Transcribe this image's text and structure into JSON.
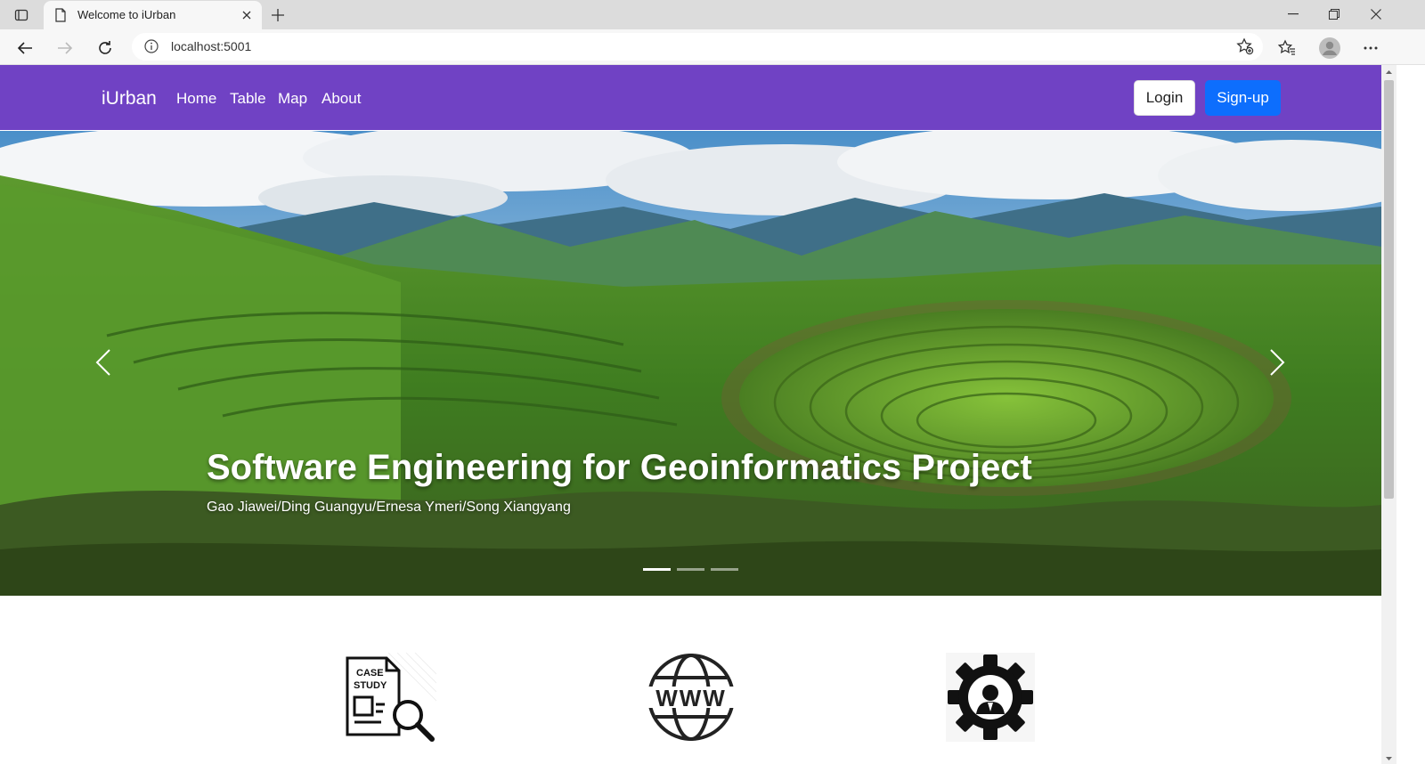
{
  "browser": {
    "tab_title": "Welcome to iUrban",
    "url": "localhost:5001",
    "accent": "#7042c4"
  },
  "navbar": {
    "brand": "iUrban",
    "links": [
      "Home",
      "Table",
      "Map",
      "About"
    ],
    "login_label": "Login",
    "signup_label": "Sign-up",
    "background": "#7042c4",
    "signup_color": "#0d6efd"
  },
  "carousel": {
    "title": "Software Engineering for Geoinformatics Project",
    "subtitle": "Gao Jiawei/Ding Guangyu/Ernesa Ymeri/Song Xiangyang",
    "slide_count": 3,
    "active_slide": 1
  },
  "features": [
    {
      "icon": "case-study-icon",
      "label": "CASE",
      "label2": "STUDY"
    },
    {
      "icon": "www-globe-icon",
      "label": "WWW"
    },
    {
      "icon": "gear-user-icon"
    }
  ]
}
